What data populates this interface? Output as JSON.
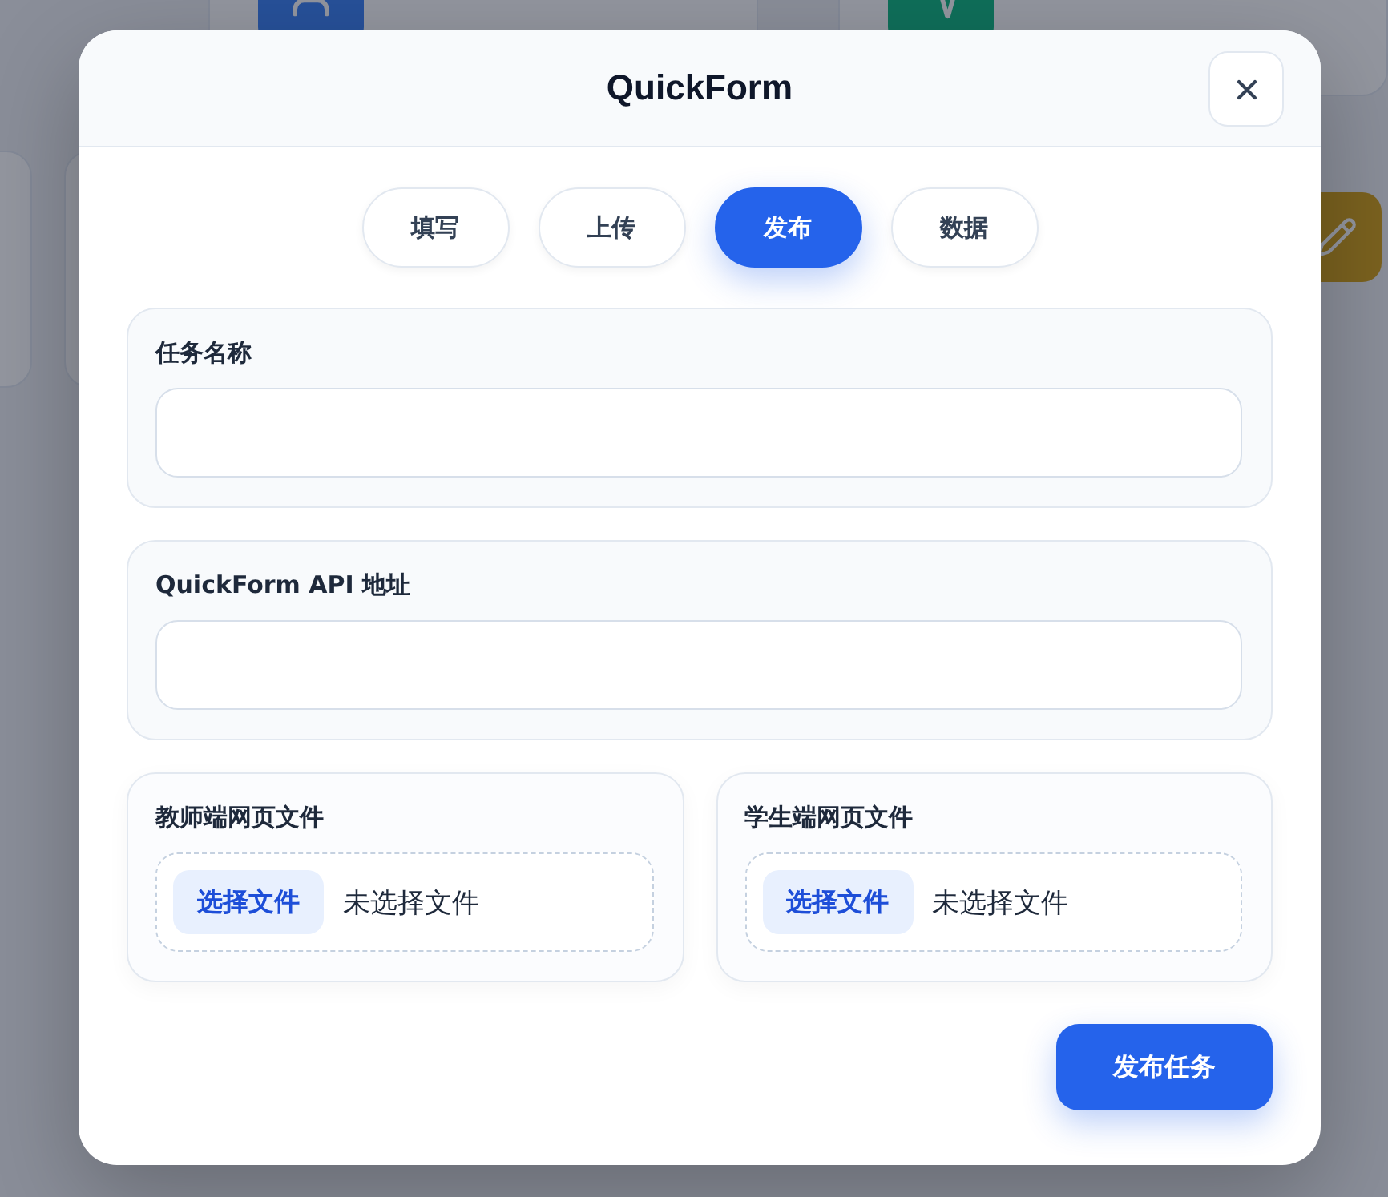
{
  "dialog": {
    "title": "QuickForm",
    "tabs": [
      {
        "label": "填写",
        "selected": false
      },
      {
        "label": "上传",
        "selected": false
      },
      {
        "label": "发布",
        "selected": true
      },
      {
        "label": "数据",
        "selected": false
      }
    ],
    "fields": [
      {
        "label": "任务名称"
      },
      {
        "label": "QuickForm API 地址"
      }
    ],
    "files": [
      {
        "label": "教师端网页文件",
        "button": "选择文件",
        "status": "未选择文件"
      },
      {
        "label": "学生端网页文件",
        "button": "选择文件",
        "status": "未选择文件"
      }
    ],
    "submit": "发布任务"
  }
}
